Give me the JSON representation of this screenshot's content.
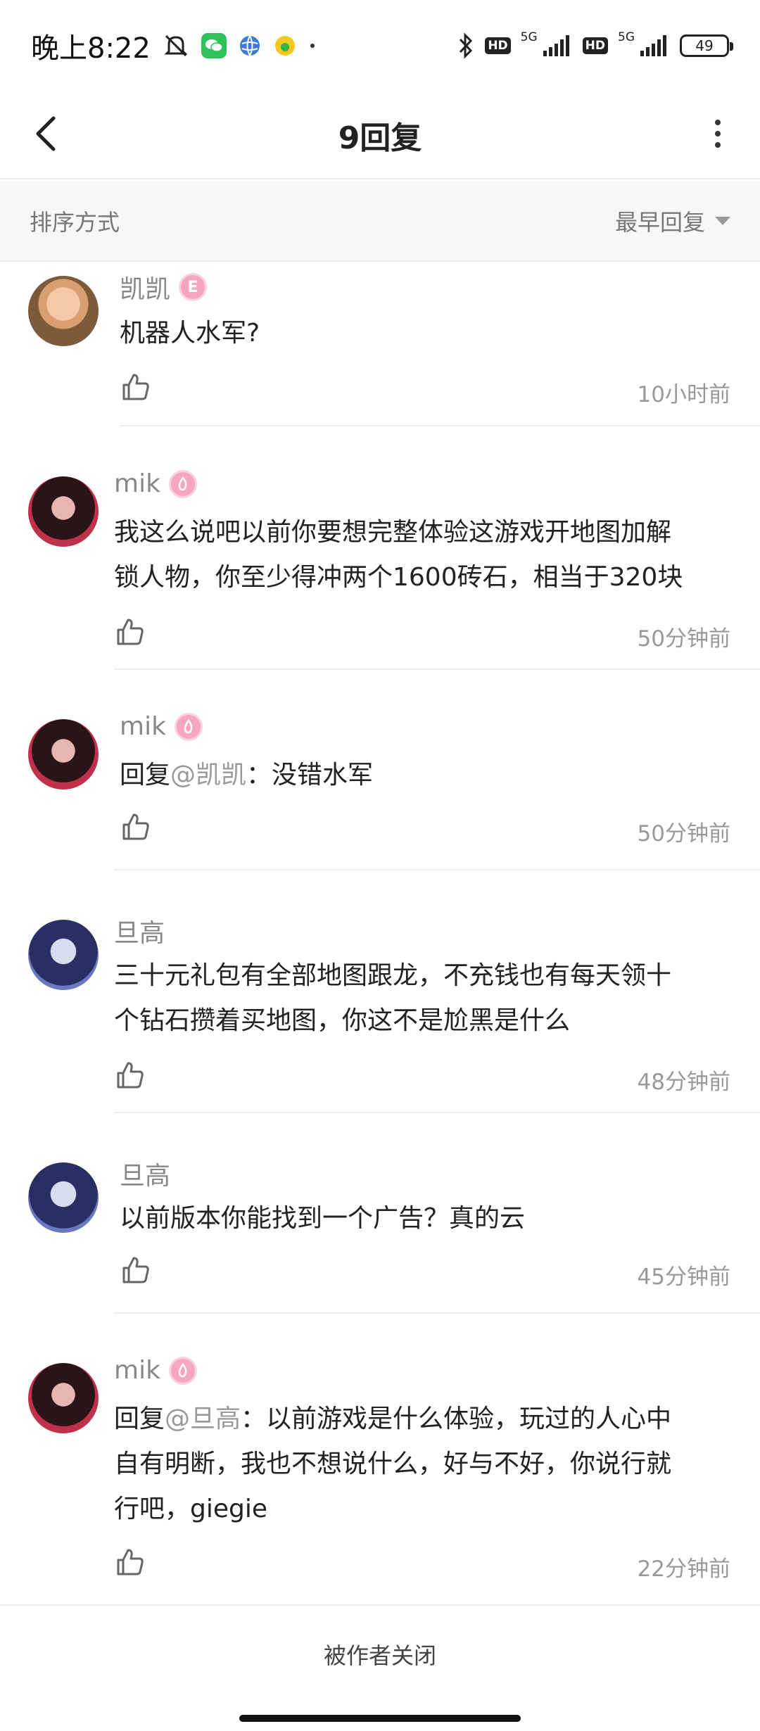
{
  "status_bar": {
    "time": "晚上8:22",
    "net_label_1": "5G",
    "net_label_2": "5G",
    "hd_1": "HD",
    "hd_2": "HD",
    "battery": "49"
  },
  "nav": {
    "title": "9回复"
  },
  "sort": {
    "label": "排序方式",
    "selected": "最早回复"
  },
  "comments": [
    {
      "username": "凯凯",
      "badge": "E",
      "text": "机器人水军?",
      "mention": "",
      "time": "10小时前"
    },
    {
      "username": "mik",
      "badge": "",
      "text_line1": "我这么说吧以前你要想完整体验这游戏开地图加解",
      "text_line2": "锁人物，你至少得冲两个1600砖石，相当于320块",
      "time": "50分钟前"
    },
    {
      "username": "mik",
      "badge": "",
      "reply_prefix": "回复",
      "mention": "@凯凯",
      "text": "：没错水军",
      "time": "50分钟前"
    },
    {
      "username": "旦高",
      "text_line1": "三十元礼包有全部地图跟龙，不充钱也有每天领十",
      "text_line2": "个钻石攒着买地图，你这不是尬黑是什么",
      "time": "48分钟前"
    },
    {
      "username": "旦高",
      "text": "以前版本你能找到一个广告？真的云",
      "time": "45分钟前"
    },
    {
      "username": "mik",
      "badge": "",
      "reply_prefix": "回复",
      "mention": "@旦高",
      "text_line1": "：以前游戏是什么体验，玩过的人心中",
      "text_line2": "自有明断，我也不想说什么，好与不好，你说行就",
      "text_line3": "行吧，giegie",
      "time": "22分钟前"
    }
  ],
  "footer": {
    "closed_text": "被作者关闭"
  },
  "colors": {
    "accent_badge": "#f6a6c0",
    "meta_text": "#999999"
  }
}
